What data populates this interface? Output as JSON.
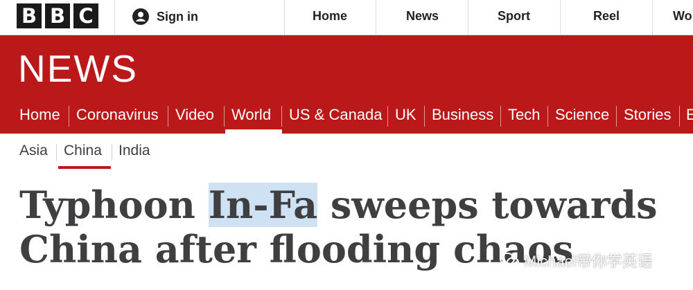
{
  "brand": {
    "letters": [
      "B",
      "B",
      "C"
    ],
    "section": "NEWS"
  },
  "account": {
    "signin_label": "Sign in"
  },
  "top_nav": [
    "Home",
    "News",
    "Sport",
    "Reel",
    "Wo"
  ],
  "section_nav": [
    "Home",
    "Coronavirus",
    "Video",
    "World",
    "US & Canada",
    "UK",
    "Business",
    "Tech",
    "Science",
    "Stories",
    "E"
  ],
  "sub_nav": [
    "Asia",
    "China",
    "India"
  ],
  "article": {
    "headline_pre": "Typhoon ",
    "headline_mark": "In-Fa",
    "headline_post": " sweeps towards China after flooding chaos"
  },
  "watermark": {
    "text": "Michael带你学英语"
  },
  "colors": {
    "brand_red": "#bb1919",
    "text_dark": "#3f3f42",
    "highlight": "#cfe2f3"
  }
}
